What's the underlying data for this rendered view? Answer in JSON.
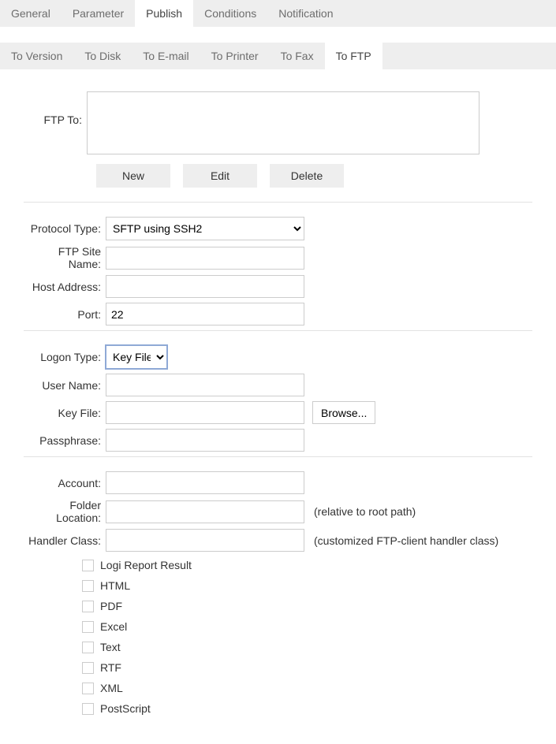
{
  "tabs": {
    "main": [
      {
        "label": "General"
      },
      {
        "label": "Parameter"
      },
      {
        "label": "Publish"
      },
      {
        "label": "Conditions"
      },
      {
        "label": "Notification"
      }
    ],
    "sub": [
      {
        "label": "To Version"
      },
      {
        "label": "To Disk"
      },
      {
        "label": "To E-mail"
      },
      {
        "label": "To Printer"
      },
      {
        "label": "To Fax"
      },
      {
        "label": "To FTP"
      }
    ],
    "main_active": 2,
    "sub_active": 5
  },
  "ftpto": {
    "label": "FTP To:",
    "value": ""
  },
  "buttons": {
    "new": "New",
    "edit": "Edit",
    "delete": "Delete",
    "browse": "Browse..."
  },
  "fields": {
    "protocol_type": {
      "label": "Protocol Type:",
      "value": "SFTP using SSH2"
    },
    "ftp_site_name": {
      "label": "FTP Site Name:",
      "value": ""
    },
    "host_address": {
      "label": "Host Address:",
      "value": ""
    },
    "port": {
      "label": "Port:",
      "value": "22"
    },
    "logon_type": {
      "label": "Logon Type:",
      "value": "Key File"
    },
    "user_name": {
      "label": "User Name:",
      "value": ""
    },
    "key_file": {
      "label": "Key File:",
      "value": ""
    },
    "passphrase": {
      "label": "Passphrase:",
      "value": ""
    },
    "account": {
      "label": "Account:",
      "value": ""
    },
    "folder_location": {
      "label": "Folder Location:",
      "value": "",
      "hint": "(relative to root path)"
    },
    "handler_class": {
      "label": "Handler Class:",
      "value": "",
      "hint": "(customized FTP-client handler class)"
    }
  },
  "formats": [
    "Logi Report Result",
    "HTML",
    "PDF",
    "Excel",
    "Text",
    "RTF",
    "XML",
    "PostScript"
  ]
}
